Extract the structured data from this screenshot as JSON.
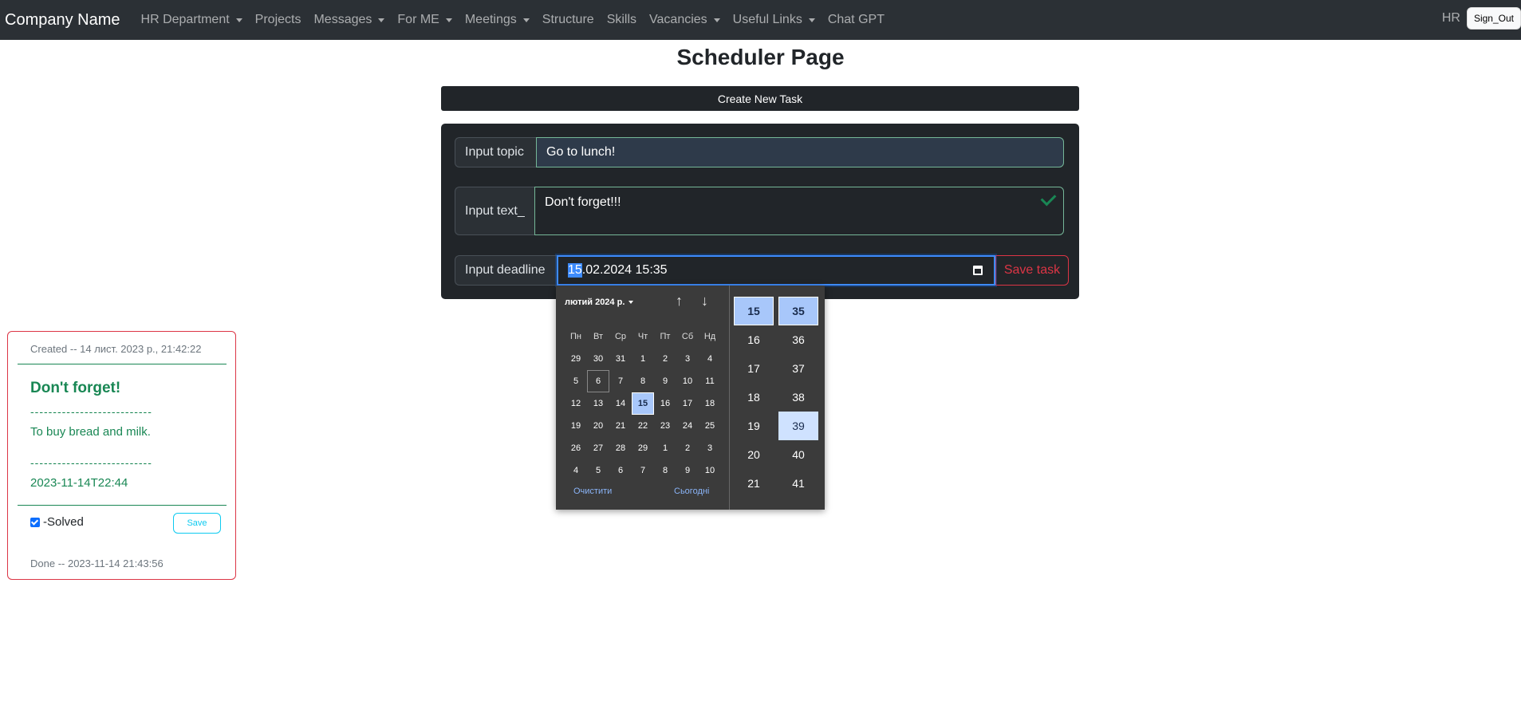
{
  "nav": {
    "brand": "Company Name",
    "items": [
      {
        "label": "HR Department",
        "dropdown": true
      },
      {
        "label": "Projects",
        "dropdown": false
      },
      {
        "label": "Messages",
        "dropdown": true
      },
      {
        "label": "For ME",
        "dropdown": true
      },
      {
        "label": "Meetings",
        "dropdown": true
      },
      {
        "label": "Structure",
        "dropdown": false
      },
      {
        "label": "Skills",
        "dropdown": false
      },
      {
        "label": "Vacancies",
        "dropdown": true
      },
      {
        "label": "Useful Links",
        "dropdown": true
      },
      {
        "label": "Chat GPT",
        "dropdown": false
      }
    ],
    "user": "HR",
    "sign_out": "Sign_Out"
  },
  "page": {
    "title": "Scheduler Page",
    "create_button": "Create New Task"
  },
  "form": {
    "topic_label": "Input topic",
    "topic_value": "Go to lunch!",
    "text_label": "Input text_",
    "text_value": "Don't forget!!!",
    "deadline_label": "Input deadline",
    "deadline_selected": "15",
    "deadline_rest": ".02.2024 15:35",
    "save_button": "Save task"
  },
  "datepicker": {
    "month_label": "лютий 2024 р.",
    "weekdays": [
      "Пн",
      "Вт",
      "Ср",
      "Чт",
      "Пт",
      "Сб",
      "Нд"
    ],
    "days": [
      "29",
      "30",
      "31",
      "1",
      "2",
      "3",
      "4",
      "5",
      "6",
      "7",
      "8",
      "9",
      "10",
      "11",
      "12",
      "13",
      "14",
      "15",
      "16",
      "17",
      "18",
      "19",
      "20",
      "21",
      "22",
      "23",
      "24",
      "25",
      "26",
      "27",
      "28",
      "29",
      "1",
      "2",
      "3",
      "4",
      "5",
      "6",
      "7",
      "8",
      "9",
      "10"
    ],
    "today_index": 8,
    "selected_index": 17,
    "clear": "Очистити",
    "today": "Сьогодні",
    "hours": [
      "15",
      "16",
      "17",
      "18",
      "19",
      "20",
      "21"
    ],
    "minutes": [
      "35",
      "36",
      "37",
      "38",
      "39",
      "40",
      "41"
    ],
    "hovered_minute": "39"
  },
  "card": {
    "created": "Created -- 14 лист. 2023 р., 21:42:22",
    "title": "Don't forget!",
    "separator": "---------------------------",
    "text": "To buy bread and milk.",
    "date": "2023-11-14T22:44",
    "solved_label": "-Solved",
    "save": "Save",
    "done": "Done -- 2023-11-14 21:43:56"
  },
  "colors": {
    "navbar": "#2b3035",
    "accent_green": "#198754",
    "danger": "#dc3545",
    "info": "#0dcaf0",
    "picker_bg": "#3b3b3b",
    "picker_selected": "#a8c7fa"
  }
}
